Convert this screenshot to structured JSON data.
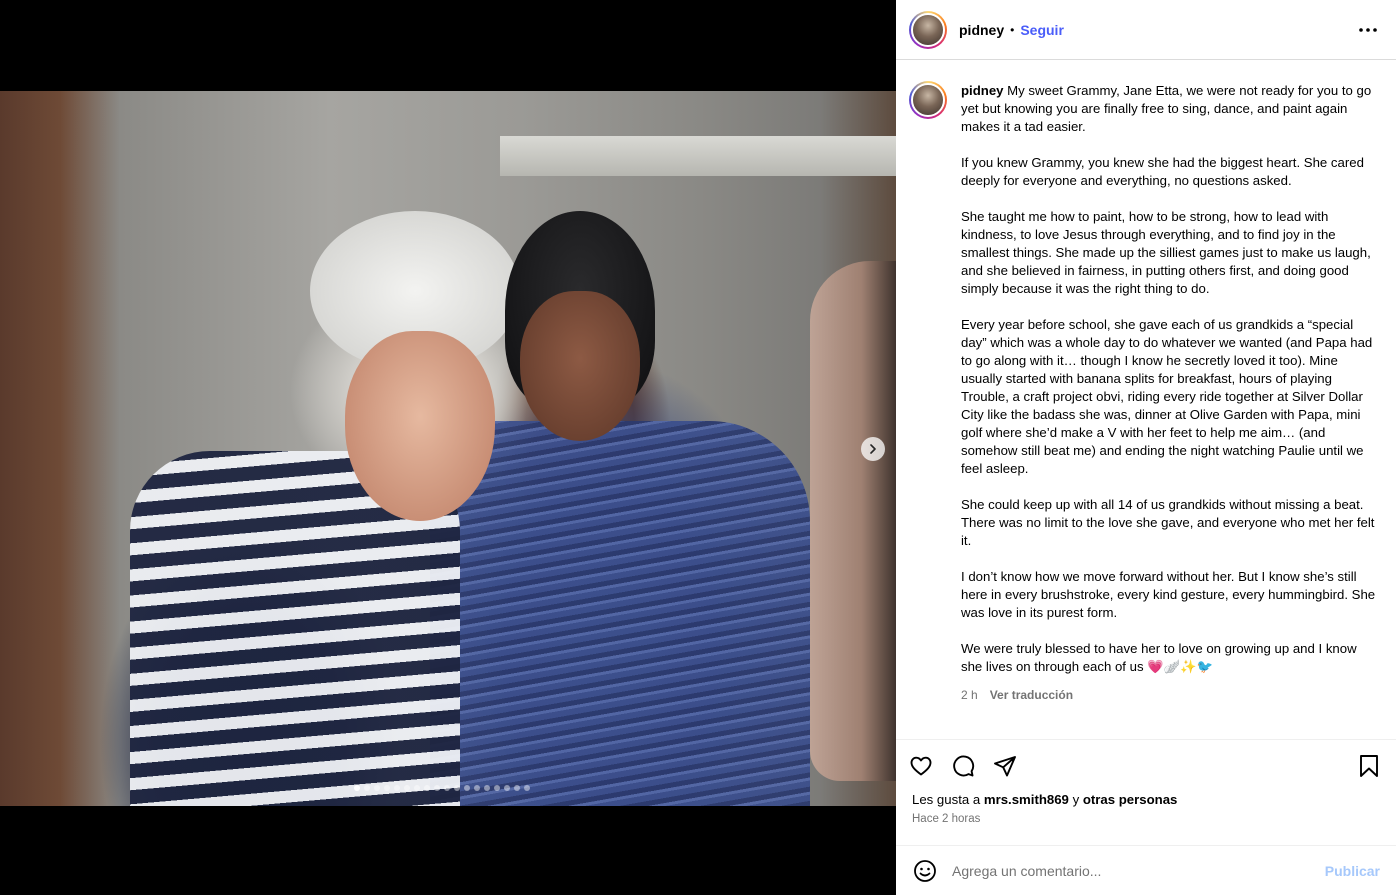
{
  "post": {
    "media": {
      "carousel_count": 18,
      "active_index": 0
    },
    "header": {
      "username": "pidney",
      "separator": "•",
      "follow_label": "Seguir",
      "more_icon": "more-horizontal-icon"
    },
    "caption": {
      "username": "pidney",
      "paragraphs": [
        "My sweet Grammy, Jane Etta, we were not ready for you to go yet but knowing you are finally free to sing, dance, and paint again makes it a tad easier.",
        "If you knew Grammy, you knew she had the biggest heart. She cared deeply for everyone and everything, no questions asked.",
        "She taught me how to paint, how to be strong, how to lead with kindness, to love Jesus through everything, and to find joy in the smallest things. She made up the silliest games just to make us laugh, and she believed in fairness, in putting others first, and doing good simply because it was the right thing to do.",
        "Every year before school, she gave each of us grandkids a “special day” which was a whole day to do whatever we wanted (and Papa had to go along with it… though I know he secretly loved it too). Mine usually started with banana splits for breakfast, hours of playing Trouble, a craft project obvi, riding every ride together at Silver Dollar City like the badass she was, dinner at Olive Garden with Papa, mini golf where she’d make a V with her feet to help me aim… (and somehow still beat me) and ending the night watching Paulie until we feel asleep.",
        "She could keep up with all 14 of us grandkids without missing a beat. There was no limit to the love she gave, and everyone who met her felt it.",
        "I don’t know how we move forward without her. But I know she’s still here in every brushstroke, every kind gesture, every hummingbird. She was love in its purest form.",
        "We were truly blessed to have her to love on growing up and I know she lives on through each of us 💗🪽✨🐦"
      ],
      "time": "2 h",
      "translate_label": "Ver traducción"
    },
    "likes": {
      "prefix": "Les gusta a",
      "user": "mrs.smith869",
      "connector": "y",
      "others": "otras personas"
    },
    "time_ago": "Hace 2 horas",
    "comment": {
      "placeholder": "Agrega un comentario...",
      "publish_label": "Publicar"
    },
    "colors": {
      "follow": "#4a5df9",
      "publish_disabled": "#a6c8fb",
      "secondary_text": "#737373"
    }
  }
}
